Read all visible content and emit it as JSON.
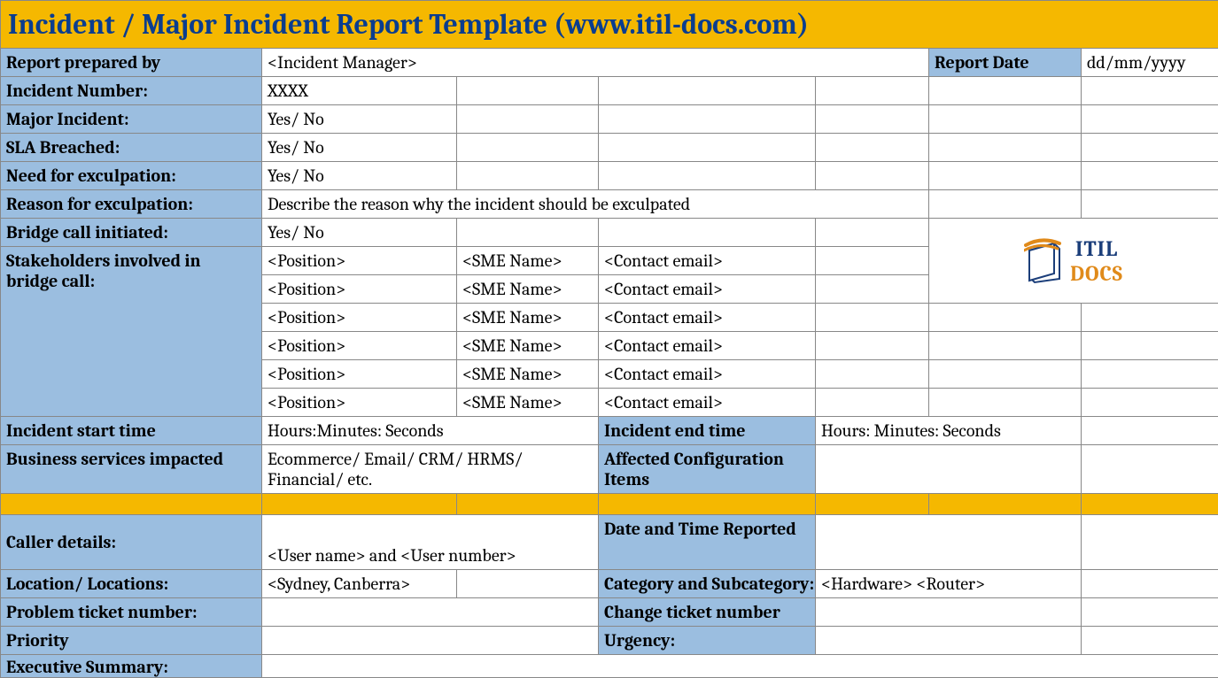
{
  "title": "Incident / Major Incident Report Template   (www.itil-docs.com)",
  "report_prepared_by_label": "Report prepared by",
  "report_prepared_by_value": "<Incident Manager>",
  "report_date_label": "Report Date",
  "report_date_value": "dd/mm/yyyy",
  "incident_number_label": "Incident Number:",
  "incident_number_value": "XXXX",
  "major_incident_label": "Major Incident:",
  "major_incident_value": "Yes/ No",
  "sla_breached_label": "SLA Breached:",
  "sla_breached_value": "Yes/ No",
  "need_exculpation_label": "Need for exculpation:",
  "need_exculpation_value": "Yes/ No",
  "reason_exculpation_label": "Reason for exculpation:",
  "reason_exculpation_value": "Describe the reason why the incident should be exculpated",
  "bridge_call_label": "Bridge call initiated:",
  "bridge_call_value": "Yes/ No",
  "stakeholders_label": "Stakeholders involved in bridge call:",
  "stakeholders": [
    {
      "position": "<Position>",
      "sme": "<SME Name>",
      "email": "<Contact email>"
    },
    {
      "position": "<Position>",
      "sme": "<SME Name>",
      "email": "<Contact email>"
    },
    {
      "position": "<Position>",
      "sme": "<SME Name>",
      "email": "<Contact email>"
    },
    {
      "position": "<Position>",
      "sme": "<SME Name>",
      "email": "<Contact email>"
    },
    {
      "position": "<Position>",
      "sme": "<SME Name>",
      "email": "<Contact email>"
    },
    {
      "position": "<Position>",
      "sme": "<SME Name>",
      "email": "<Contact email>"
    }
  ],
  "incident_start_label": "Incident start time",
  "incident_start_value": "Hours:Minutes: Seconds",
  "incident_end_label": "Incident end time",
  "incident_end_value": "Hours: Minutes: Seconds",
  "biz_services_label": "Business services impacted",
  "biz_services_value": "Ecommerce/ Email/ CRM/ HRMS/ Financial/ etc.",
  "affected_ci_label": "Affected Configuration Items",
  "caller_details_label": "Caller details:",
  "caller_details_value": "<User name> and <User number>",
  "date_time_reported_label": "Date and Time Reported",
  "location_label": "Location/ Locations:",
  "location_value": "<Sydney, Canberra>",
  "category_label": "Category and Subcategory:",
  "category_value": "<Hardware> <Router>",
  "problem_ticket_label": "Problem ticket number:",
  "change_ticket_label": "Change ticket number",
  "priority_label": "Priority",
  "urgency_label": "Urgency:",
  "exec_summary_label": "Executive Summary:",
  "logo_itil": "ITIL",
  "logo_docs": "DOCS"
}
